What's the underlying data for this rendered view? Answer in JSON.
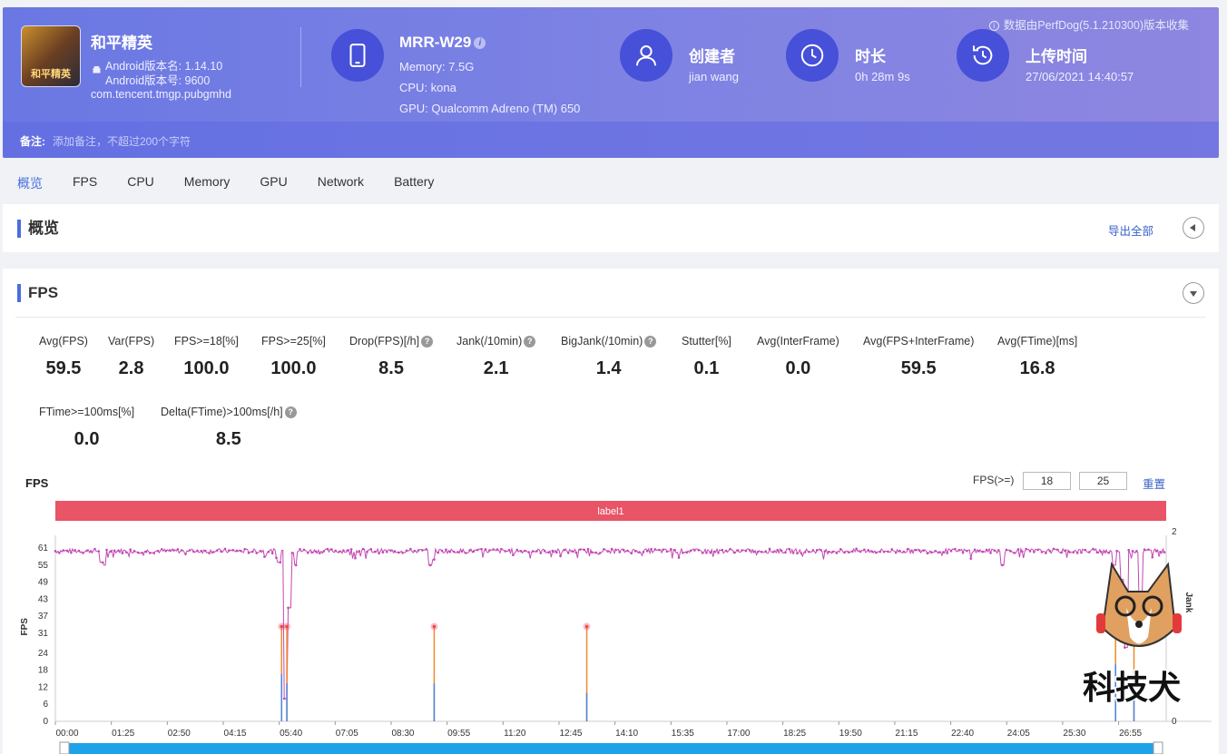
{
  "header": {
    "collect_note": "数据由PerfDog(5.1.210300)版本收集",
    "app": {
      "name": "和平精英",
      "icon_text": "和平精英",
      "version_name": "Android版本名: 1.14.10",
      "version_code": "Android版本号: 9600",
      "package": "com.tencent.tmgp.pubgmhd"
    },
    "device": {
      "model": "MRR-W29",
      "memory": "Memory: 7.5G",
      "cpu": "CPU: kona",
      "gpu": "GPU: Qualcomm Adreno (TM) 650"
    },
    "creator": {
      "title": "创建者",
      "value": "jian wang"
    },
    "duration": {
      "title": "时长",
      "value": "0h 28m 9s"
    },
    "upload": {
      "title": "上传时间",
      "value": "27/06/2021 14:40:57"
    },
    "note": {
      "label": "备注:",
      "placeholder": "添加备注，不超过200个字符"
    }
  },
  "tabs": [
    "概览",
    "FPS",
    "CPU",
    "Memory",
    "GPU",
    "Network",
    "Battery"
  ],
  "overview": {
    "title": "概览",
    "export": "导出全部"
  },
  "fps_panel": {
    "title": "FPS",
    "metrics_row1": [
      {
        "label": "Avg(FPS)",
        "value": "59.5",
        "help": false
      },
      {
        "label": "Var(FPS)",
        "value": "2.8",
        "help": false
      },
      {
        "label": "FPS>=18[%]",
        "value": "100.0",
        "help": false
      },
      {
        "label": "FPS>=25[%]",
        "value": "100.0",
        "help": false
      },
      {
        "label": "Drop(FPS)[/h]",
        "value": "8.5",
        "help": true
      },
      {
        "label": "Jank(/10min)",
        "value": "2.1",
        "help": true
      },
      {
        "label": "BigJank(/10min)",
        "value": "1.4",
        "help": true
      },
      {
        "label": "Stutter[%]",
        "value": "0.1",
        "help": false
      },
      {
        "label": "Avg(InterFrame)",
        "value": "0.0",
        "help": false
      },
      {
        "label": "Avg(FPS+InterFrame)",
        "value": "59.5",
        "help": false
      },
      {
        "label": "Avg(FTime)[ms]",
        "value": "16.8",
        "help": false
      }
    ],
    "metrics_row2": [
      {
        "label": "FTime>=100ms[%]",
        "value": "0.0",
        "help": false
      },
      {
        "label": "Delta(FTime)>100ms[/h]",
        "value": "8.5",
        "help": true
      }
    ],
    "chart_controls": {
      "label": "FPS",
      "threshold_label": "FPS(>=)",
      "threshold1": "18",
      "threshold2": "25",
      "reset": "重置"
    }
  },
  "chart_data": {
    "type": "line",
    "title": "FPS",
    "band_label": "label1",
    "ylabel": "FPS",
    "y2label": "Jank",
    "y_ticks": [
      0,
      6,
      12,
      18,
      24,
      31,
      37,
      43,
      49,
      55,
      61
    ],
    "y2_ticks": [
      0,
      1,
      2
    ],
    "ylim": [
      0,
      70
    ],
    "y2lim": [
      0,
      2
    ],
    "x_ticks": [
      "00:00",
      "01:25",
      "02:50",
      "04:15",
      "05:40",
      "07:05",
      "08:30",
      "09:55",
      "11:20",
      "12:45",
      "14:10",
      "15:35",
      "17:00",
      "18:25",
      "19:50",
      "21:15",
      "22:40",
      "24:05",
      "25:30",
      "26:55"
    ],
    "duration_seconds": 1689,
    "series": [
      {
        "name": "FPS",
        "color": "#c447b4",
        "baseline": 60,
        "dips": [
          [
            70,
            56
          ],
          [
            75,
            55
          ],
          [
            340,
            56
          ],
          [
            350,
            8
          ],
          [
            356,
            40
          ],
          [
            365,
            55
          ],
          [
            570,
            55
          ],
          [
            575,
            57
          ],
          [
            1440,
            55
          ],
          [
            1610,
            55
          ],
          [
            1622,
            50
          ],
          [
            1628,
            26
          ],
          [
            1650,
            40
          ]
        ]
      },
      {
        "name": "Jank",
        "color": "#f08a2c",
        "events": [
          [
            344,
            1
          ],
          [
            352,
            1
          ],
          [
            576,
            1
          ],
          [
            808,
            1
          ],
          [
            1612,
            1
          ],
          [
            1640,
            1
          ]
        ]
      },
      {
        "name": "BigJank",
        "color": "#4a86e8",
        "events": [
          [
            344,
            0.5
          ],
          [
            352,
            0.4
          ],
          [
            576,
            0.4
          ],
          [
            808,
            0.3
          ],
          [
            1612,
            0.6
          ],
          [
            1640,
            0.5
          ]
        ]
      }
    ],
    "legend": "none",
    "grid": false
  },
  "colors": {
    "accent": "#4a6ee0",
    "band": "#e95466",
    "header": "#6a78e3"
  },
  "watermark_text": "科技犬"
}
